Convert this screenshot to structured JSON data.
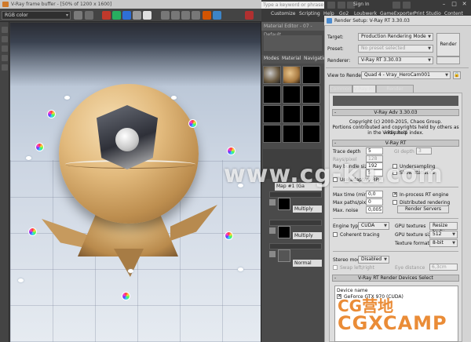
{
  "vfb": {
    "title": "V-Ray frame buffer - [50% of 1200 x 1600]",
    "channel": "RGB color"
  },
  "topbar": {
    "search_placeholder": "Type a keyword or phrase",
    "sign_in": "Sign In",
    "menu": [
      "Customize",
      "Scripting",
      "Help",
      "Go2",
      "Loubwerk",
      "GameExporter",
      "Print Studio",
      "Content"
    ]
  },
  "material_editor": {
    "title": "Material Editor - 07 - Default",
    "menu": [
      "Modes",
      "Material",
      "Navigation"
    ],
    "map_field": "Map #1 (Ga",
    "rows": [
      {
        "blend": "Multiply"
      },
      {
        "blend": "Multiply"
      },
      {
        "blend": "Normal"
      }
    ]
  },
  "render_setup": {
    "title": "Render Setup: V-Ray RT 3.30.03",
    "target_label": "Target:",
    "target_value": "Production Rendering Mode",
    "preset_label": "Preset:",
    "preset_value": "No preset selected",
    "renderer_label": "Renderer:",
    "renderer_value": "V-Ray RT 3.30.03",
    "render_button": "Render",
    "view_label": "View to Render:",
    "view_value": "Quad 4 - Vray_HeroCam001",
    "tabs": [
      "Common",
      "V-Ray RT",
      "Render Elements"
    ],
    "about_rollout": "V-Ray Adv 3.30.03",
    "copyright_1": "Copyright (c) 2000-2015, Chaos Group.",
    "copyright_2": "Portions contributed and copyrights held by others as indicated",
    "copyright_3": "in the V-Ray help index.",
    "vrayrt_rollout": "V-Ray RT",
    "trace_depth_label": "Trace depth",
    "trace_depth": "5",
    "gi_depth_label": "GI depth",
    "gi_depth": "3",
    "rays_per_pixel_label": "Rays/pixel",
    "rays_per_pixel": "128",
    "ray_bundle_label": "Ray bundle size",
    "ray_bundle": "192",
    "adaptive_label": "Use adaptive RPP",
    "undersampling_label": "Undersampling",
    "show_stats_label": "Show statistics",
    "max_time_label": "Max time (min)",
    "max_time": "0,0",
    "max_paths_label": "Max paths/pixel",
    "max_paths": "0",
    "max_noise_label": "Max. noise",
    "max_noise": "0,005",
    "in_process_label": "In-process RT engine",
    "distributed_label": "Distributed rendering",
    "render_servers_label": "Render Servers",
    "engine_type_label": "Engine type",
    "engine_type": "CUDA",
    "coherent_label": "Coherent tracing",
    "gpu_textures_label": "GPU textures",
    "gpu_textures": "Resize textu",
    "gpu_tex_size_label": "GPU texture size",
    "gpu_tex_size": "512",
    "texture_format_label": "Texture format",
    "texture_format": "8-bit",
    "stereo_label": "Stereo mode",
    "stereo_value": "Disabled",
    "swap_label": "Swap left/right",
    "eye_distance_label": "Eye distance",
    "eye_distance": "6,3cm",
    "devices_rollout": "V-Ray RT Render Devices Select",
    "device_header": "Device name",
    "device_item": "GeForce GTX 970 (CUDA)"
  },
  "watermark": {
    "site": "www.cg-ku.com",
    "brand_top": "CG营地",
    "brand_bottom": "CGXCAMP"
  },
  "colors": {
    "vfb_bg": "#3c3c3c",
    "render_setup_bg": "#d4d4d4",
    "wood": "#d9b275",
    "watermark_orange": "#e6781a"
  }
}
